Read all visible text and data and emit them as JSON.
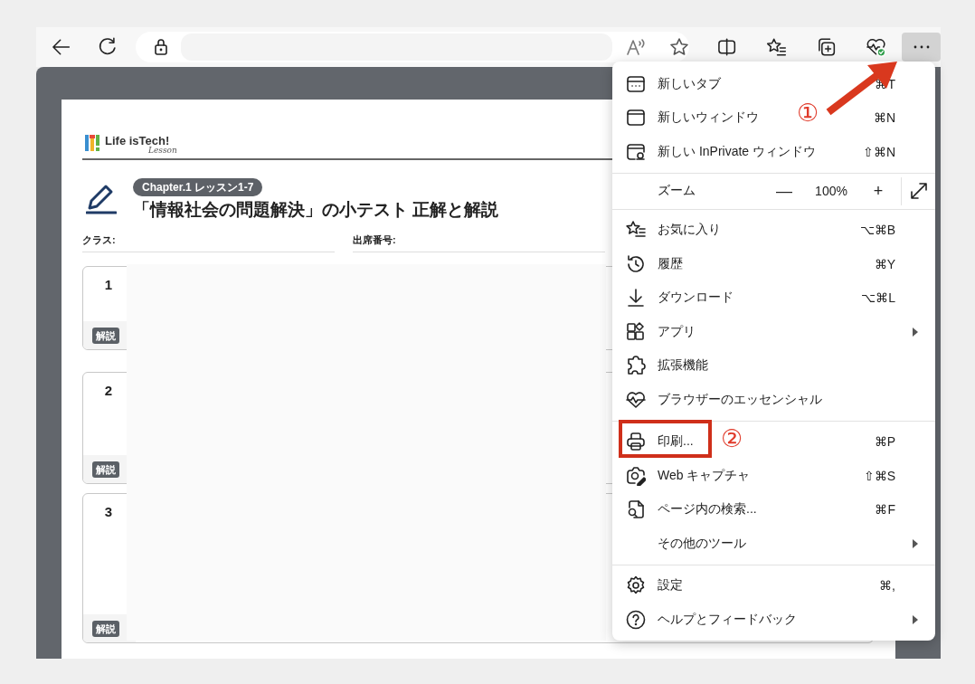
{
  "toolbar": {
    "menu_button_active": true
  },
  "document": {
    "logo_text": "Life isTech!",
    "logo_subtext": "Lesson",
    "chapter_badge": "Chapter.1 レッスン1-7",
    "title": "「情報社会の問題解決」の小テスト 正解と解説",
    "fields": [
      {
        "label": "クラス:"
      },
      {
        "label": "出席番号:"
      }
    ],
    "questions": [
      {
        "number": "1",
        "badge": "解説"
      },
      {
        "number": "2",
        "badge": "解説"
      },
      {
        "number": "3",
        "badge": "解説"
      }
    ]
  },
  "menu": {
    "items": [
      {
        "kind": "item",
        "label": "新しいタブ",
        "shortcut": "⌘T",
        "submenu": false
      },
      {
        "kind": "item",
        "label": "新しいウィンドウ",
        "shortcut": "⌘N",
        "submenu": false
      },
      {
        "kind": "item",
        "label": "新しい InPrivate ウィンドウ",
        "shortcut": "⇧⌘N",
        "submenu": false
      },
      {
        "kind": "separator"
      },
      {
        "kind": "zoom",
        "label": "ズーム",
        "zoom_out": "—",
        "value": "100%",
        "zoom_in": "+"
      },
      {
        "kind": "separator"
      },
      {
        "kind": "item",
        "label": "お気に入り",
        "shortcut": "⌥⌘B",
        "submenu": false
      },
      {
        "kind": "item",
        "label": "履歴",
        "shortcut": "⌘Y",
        "submenu": false
      },
      {
        "kind": "item",
        "label": "ダウンロード",
        "shortcut": "⌥⌘L",
        "submenu": false
      },
      {
        "kind": "item",
        "label": "アプリ",
        "submenu": true
      },
      {
        "kind": "item",
        "label": "拡張機能",
        "submenu": false
      },
      {
        "kind": "item",
        "label": "ブラウザーのエッセンシャル",
        "submenu": false
      },
      {
        "kind": "separator"
      },
      {
        "kind": "item",
        "label": "印刷...",
        "shortcut": "⌘P",
        "submenu": false
      },
      {
        "kind": "item",
        "label": "Web キャプチャ",
        "shortcut": "⇧⌘S",
        "submenu": false
      },
      {
        "kind": "item",
        "label": "ページ内の検索...",
        "shortcut": "⌘F",
        "submenu": false
      },
      {
        "kind": "item",
        "label": "その他のツール",
        "submenu": true
      },
      {
        "kind": "separator"
      },
      {
        "kind": "item",
        "label": "設定",
        "shortcut": "⌘,",
        "submenu": false
      },
      {
        "kind": "item",
        "label": "ヘルプとフィードバック",
        "submenu": true
      }
    ]
  },
  "annotations": [
    {
      "kind": "arrow",
      "label": "①"
    },
    {
      "kind": "box",
      "label": "②"
    }
  ]
}
